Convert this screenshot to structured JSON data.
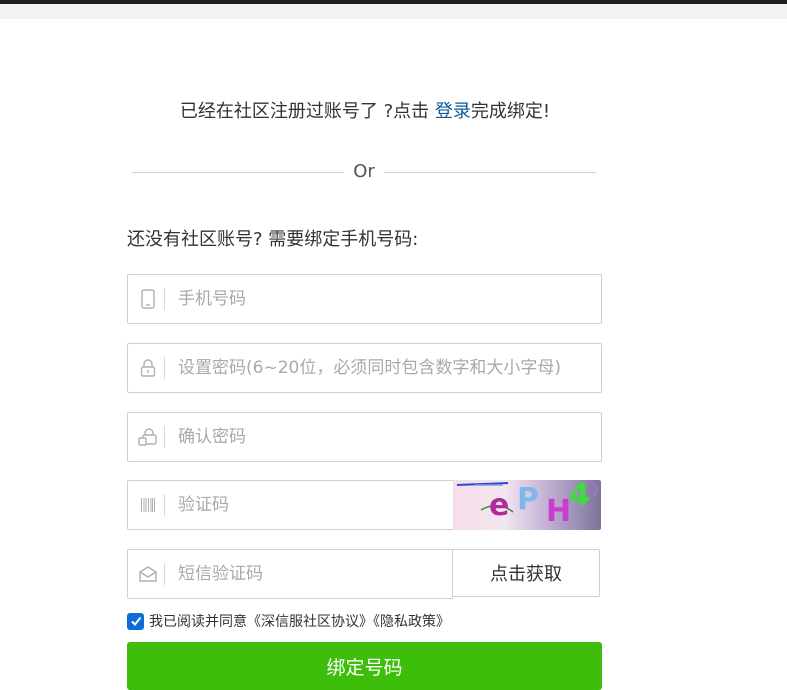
{
  "login_prompt": {
    "text_before": "已经在社区注册过账号了 ?点击 ",
    "link": "登录",
    "text_after": "完成绑定!"
  },
  "divider": {
    "text": "Or"
  },
  "register_prompt": "还没有社区账号? 需要绑定手机号码:",
  "fields": {
    "phone": {
      "placeholder": "手机号码",
      "value": ""
    },
    "password": {
      "placeholder": "设置密码(6~20位，必须同时包含数字和大小字母)",
      "value": ""
    },
    "confirm": {
      "placeholder": "确认密码",
      "value": ""
    },
    "captcha": {
      "placeholder": "验证码",
      "value": ""
    },
    "sms": {
      "placeholder": "短信验证码",
      "value": ""
    }
  },
  "captcha_image": {
    "chars": [
      "e",
      "P",
      "H",
      "4"
    ]
  },
  "sms_button": "点击获取",
  "agreement": {
    "checked": true,
    "text": "我已阅读并同意《深信服社区协议》《隐私政策》"
  },
  "submit_button": "绑定号码",
  "colors": {
    "link": "#0a5a9c",
    "primary_button": "#3cbe0b",
    "checkbox": "#0f6bd6"
  },
  "icons": [
    "phone-icon",
    "lock-icon",
    "lock-confirm-icon",
    "barcode-icon",
    "envelope-icon",
    "checkmark-icon"
  ]
}
